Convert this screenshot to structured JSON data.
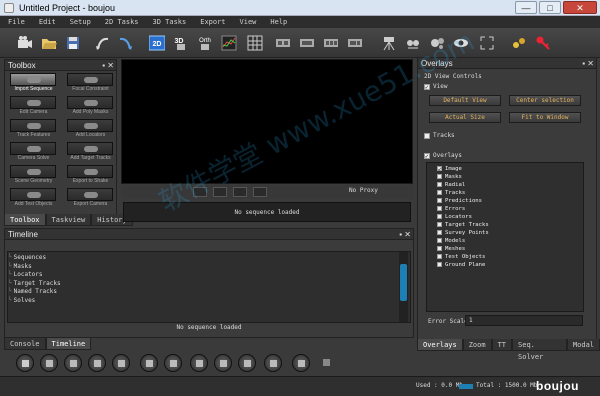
{
  "window": {
    "title": "Untitled Project - boujou",
    "minimize": "—",
    "maximize": "□",
    "close": "✕"
  },
  "menu": [
    "File",
    "Edit",
    "Setup",
    "2D Tasks",
    "3D Tasks",
    "Export",
    "View",
    "Help"
  ],
  "toolbar_icons": [
    "camera-icon",
    "open-folder-icon",
    "save-icon",
    "undo-curve-icon",
    "redo-curve-icon",
    "view-2d-icon",
    "view-3d-icon",
    "view-orth-icon",
    "graph-icon",
    "grid-icon",
    "film-strip-icon",
    "film-strip-2-icon",
    "film-strip-3-icon",
    "film-strip-4-icon",
    "tripod-icon",
    "track-icon",
    "solve-icon",
    "eye-icon",
    "frame-icon",
    "points-icon",
    "key-icon"
  ],
  "toolbar_labels": {
    "view2d": "2D",
    "view3d": "3D",
    "orth": "Orth"
  },
  "toolbox": {
    "title": "Toolbox",
    "tools": [
      "Import Sequence",
      "Focal Constraint",
      "Edit Camera",
      "Add Poly Masks",
      "Track Features",
      "Add Locators",
      "Camera Solve",
      "Add Target Tracks",
      "Scene Geometry",
      "Export to Shake",
      "Add Test Objects",
      "Export Camera"
    ],
    "tabs": [
      "Toolbox",
      "Taskview",
      "History"
    ]
  },
  "viewer": {
    "proxy": "No Proxy",
    "sequence_status": "No sequence loaded"
  },
  "timeline": {
    "title": "Timeline",
    "tree": [
      "Sequences",
      "Masks",
      "Locators",
      "Target Tracks",
      "Named Tracks",
      "Solves"
    ],
    "status": "No sequence loaded",
    "tabs": [
      "Console",
      "Timeline"
    ]
  },
  "overlays": {
    "title": "Overlays",
    "view_controls": "2D View Controls",
    "view_label": "View",
    "buttons": [
      "Default View",
      "Center selection",
      "Actual Size",
      "Fit to Window"
    ],
    "tracks_label": "Tracks",
    "overlays_label": "Overlays",
    "items": [
      "Image",
      "Masks",
      "Radial",
      "Tracks",
      "Predictions",
      "Errors",
      "Locators",
      "Target Tracks",
      "Survey Points",
      "Models",
      "Meshes",
      "Test Objects",
      "Ground Plane"
    ],
    "error_scale_label": "Error Scale",
    "error_scale_value": "1",
    "tabs": [
      "Overlays",
      "Zoom",
      "TT",
      "Seq. Solver",
      "Modal"
    ]
  },
  "status": {
    "used": "Used : 0.0 Mb",
    "total": "Total : 1500.0 Mb",
    "logo": "boujou"
  },
  "watermark": "软件学堂 www.xue51.com"
}
